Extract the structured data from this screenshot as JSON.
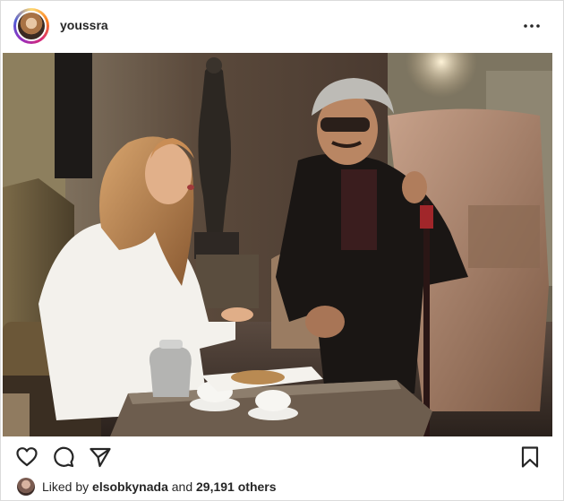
{
  "post": {
    "username": "youssra",
    "photo_alt": "",
    "likes": {
      "prefix": "Liked by ",
      "liker": "elsobkynada",
      "connector": " and ",
      "others": "29,191 others"
    }
  },
  "icons": {
    "more": "more-options-icon",
    "like": "heart-icon",
    "comment": "comment-icon",
    "share": "share-icon",
    "save": "bookmark-icon"
  },
  "colors": {
    "text": "#262626",
    "border": "#dbdbdb",
    "story_ring": "#d62976"
  }
}
